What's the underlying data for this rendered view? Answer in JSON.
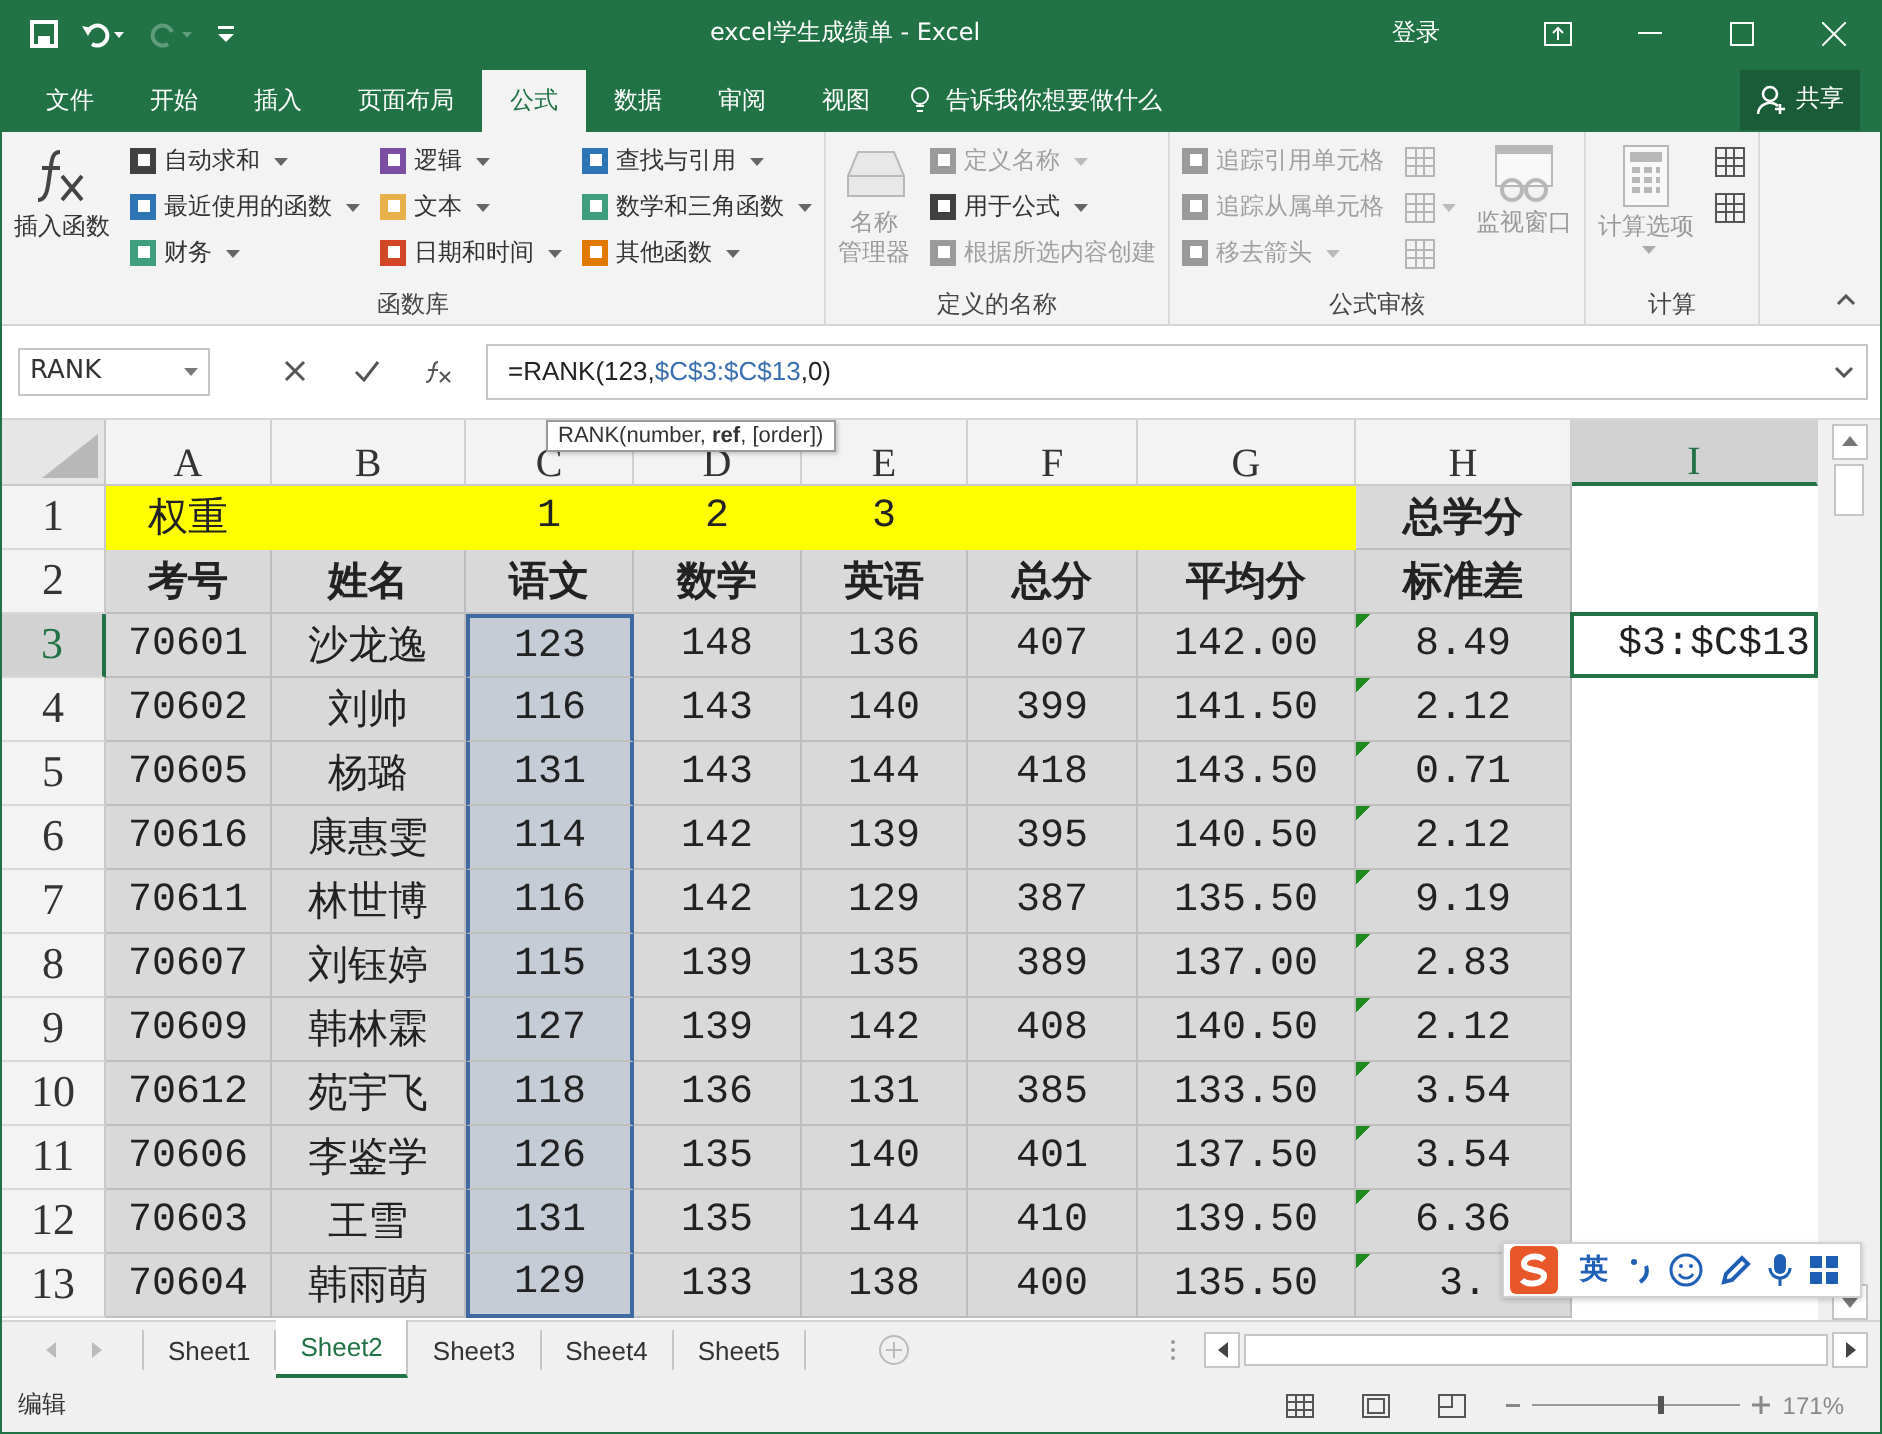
{
  "window": {
    "title": "excel学生成绩单 - Excel",
    "sign_in": "登录"
  },
  "ribbon_tabs": [
    {
      "label": "文件",
      "selected": false
    },
    {
      "label": "开始",
      "selected": false
    },
    {
      "label": "插入",
      "selected": false
    },
    {
      "label": "页面布局",
      "selected": false
    },
    {
      "label": "公式",
      "selected": true
    },
    {
      "label": "数据",
      "selected": false
    },
    {
      "label": "审阅",
      "selected": false
    },
    {
      "label": "视图",
      "selected": false
    }
  ],
  "tell_me": {
    "placeholder": "告诉我你想要做什么"
  },
  "share": "共享",
  "ribbon": {
    "groups": [
      {
        "label": "函数库",
        "parts": [
          {
            "kind": "large",
            "lines": [
              "插入函数"
            ],
            "disabled": false,
            "dropdown": false
          },
          {
            "kind": "stack",
            "items": [
              {
                "label": "自动求和",
                "dropdown": true,
                "disabled": false,
                "color": "#404040"
              },
              {
                "label": "最近使用的函数",
                "dropdown": true,
                "disabled": false,
                "color": "#2e75b6"
              },
              {
                "label": "财务",
                "dropdown": true,
                "disabled": false,
                "color": "#3f9e7e"
              }
            ]
          },
          {
            "kind": "stack",
            "items": [
              {
                "label": "逻辑",
                "dropdown": true,
                "disabled": false,
                "color": "#7c4ea3"
              },
              {
                "label": "文本",
                "dropdown": true,
                "disabled": false,
                "color": "#e8b04a"
              },
              {
                "label": "日期和时间",
                "dropdown": true,
                "disabled": false,
                "color": "#d24726"
              }
            ]
          },
          {
            "kind": "stack",
            "items": [
              {
                "label": "查找与引用",
                "dropdown": true,
                "disabled": false,
                "color": "#2e75b6"
              },
              {
                "label": "数学和三角函数",
                "dropdown": true,
                "disabled": false,
                "color": "#3f9e7e"
              },
              {
                "label": "其他函数",
                "dropdown": true,
                "disabled": false,
                "color": "#e07b00"
              }
            ]
          }
        ]
      },
      {
        "label": "定义的名称",
        "parts": [
          {
            "kind": "large",
            "lines": [
              "名称",
              "管理器"
            ],
            "disabled": true,
            "dropdown": false
          },
          {
            "kind": "stack",
            "items": [
              {
                "label": "定义名称",
                "dropdown": true,
                "disabled": true,
                "color": "#9a9a9a"
              },
              {
                "label": "用于公式",
                "dropdown": true,
                "disabled": false,
                "color": "#404040"
              },
              {
                "label": "根据所选内容创建",
                "dropdown": false,
                "disabled": true,
                "color": "#9a9a9a"
              }
            ]
          }
        ]
      },
      {
        "label": "公式审核",
        "parts": [
          {
            "kind": "stack",
            "items": [
              {
                "label": "追踪引用单元格",
                "dropdown": false,
                "disabled": true,
                "color": "#9a9a9a"
              },
              {
                "label": "追踪从属单元格",
                "dropdown": false,
                "disabled": true,
                "color": "#9a9a9a"
              },
              {
                "label": "移去箭头",
                "dropdown": true,
                "disabled": true,
                "color": "#9a9a9a"
              }
            ]
          },
          {
            "kind": "icons",
            "items": [
              {
                "disabled": true,
                "dropdown": false
              },
              {
                "disabled": true,
                "dropdown": true
              },
              {
                "disabled": true,
                "dropdown": false
              }
            ]
          },
          {
            "kind": "large",
            "lines": [
              "监视窗口"
            ],
            "disabled": true,
            "dropdown": false
          }
        ]
      },
      {
        "label": "计算",
        "parts": [
          {
            "kind": "large",
            "lines": [
              "计算选项"
            ],
            "disabled": true,
            "dropdown": true
          },
          {
            "kind": "icons",
            "items": [
              {
                "disabled": false,
                "dropdown": false
              },
              {
                "disabled": false,
                "dropdown": false
              }
            ]
          }
        ]
      }
    ]
  },
  "formula_bar": {
    "name_box": "RANK",
    "formula": {
      "prefix": "=RANK(123,",
      "reference": "$C$3:$C$13",
      "suffix": ",0)"
    }
  },
  "tooltip": "RANK(number, **ref**, [order])",
  "columns": [
    {
      "label": "A",
      "selected": false,
      "range": false
    },
    {
      "label": "B",
      "selected": false,
      "range": false
    },
    {
      "label": "C",
      "selected": false,
      "range": true
    },
    {
      "label": "D",
      "selected": false,
      "range": false
    },
    {
      "label": "E",
      "selected": false,
      "range": false
    },
    {
      "label": "F",
      "selected": false,
      "range": false
    },
    {
      "label": "G",
      "selected": false,
      "range": false
    },
    {
      "label": "H",
      "selected": false,
      "range": false
    },
    {
      "label": "I",
      "selected": true,
      "range": false
    }
  ],
  "rows": [
    {
      "number": "1",
      "kind": "weights",
      "selected": false,
      "range": false,
      "flag": false,
      "cells": [
        "权重",
        null,
        "1",
        "2",
        "3",
        null,
        null,
        "总学分",
        null
      ]
    },
    {
      "number": "2",
      "kind": "header",
      "selected": false,
      "range": false,
      "flag": false,
      "cells": [
        "考号",
        "姓名",
        "语文",
        "数学",
        "英语",
        "总分",
        "平均分",
        "标准差",
        null
      ]
    },
    {
      "number": "3",
      "kind": "data",
      "selected": true,
      "range": true,
      "flag": true,
      "cells": [
        "70601",
        "沙龙逸",
        "123",
        "148",
        "136",
        "407",
        "142.00",
        "8.49",
        null
      ]
    },
    {
      "number": "4",
      "kind": "data",
      "selected": false,
      "range": true,
      "flag": true,
      "cells": [
        "70602",
        "刘帅",
        "116",
        "143",
        "140",
        "399",
        "141.50",
        "2.12",
        null
      ]
    },
    {
      "number": "5",
      "kind": "data",
      "selected": false,
      "range": true,
      "flag": true,
      "cells": [
        "70605",
        "杨璐",
        "131",
        "143",
        "144",
        "418",
        "143.50",
        "0.71",
        null
      ]
    },
    {
      "number": "6",
      "kind": "data",
      "selected": false,
      "range": true,
      "flag": true,
      "cells": [
        "70616",
        "康惠雯",
        "114",
        "142",
        "139",
        "395",
        "140.50",
        "2.12",
        null
      ]
    },
    {
      "number": "7",
      "kind": "data",
      "selected": false,
      "range": true,
      "flag": true,
      "cells": [
        "70611",
        "林世博",
        "116",
        "142",
        "129",
        "387",
        "135.50",
        "9.19",
        null
      ]
    },
    {
      "number": "8",
      "kind": "data",
      "selected": false,
      "range": true,
      "flag": true,
      "cells": [
        "70607",
        "刘钰婷",
        "115",
        "139",
        "135",
        "389",
        "137.00",
        "2.83",
        null
      ]
    },
    {
      "number": "9",
      "kind": "data",
      "selected": false,
      "range": true,
      "flag": true,
      "cells": [
        "70609",
        "韩林霖",
        "127",
        "139",
        "142",
        "408",
        "140.50",
        "2.12",
        null
      ]
    },
    {
      "number": "10",
      "kind": "data",
      "selected": false,
      "range": true,
      "flag": true,
      "cells": [
        "70612",
        "苑宇飞",
        "118",
        "136",
        "131",
        "385",
        "133.50",
        "3.54",
        null
      ]
    },
    {
      "number": "11",
      "kind": "data",
      "selected": false,
      "range": true,
      "flag": true,
      "cells": [
        "70606",
        "李鉴学",
        "126",
        "135",
        "140",
        "401",
        "137.50",
        "3.54",
        null
      ]
    },
    {
      "number": "12",
      "kind": "data",
      "selected": false,
      "range": true,
      "flag": true,
      "cells": [
        "70603",
        "王雪",
        "131",
        "135",
        "144",
        "410",
        "139.50",
        "6.36",
        null
      ]
    },
    {
      "number": "13",
      "kind": "data",
      "selected": false,
      "range": true,
      "flag": true,
      "cells": [
        "70604",
        "韩雨萌",
        "129",
        "133",
        "138",
        "400",
        "135.50",
        "3.",
        null
      ]
    }
  ],
  "editor": {
    "text": "$3:$C$13"
  },
  "sheets": [
    {
      "label": "Sheet1",
      "selected": false
    },
    {
      "label": "Sheet2",
      "selected": true
    },
    {
      "label": "Sheet3",
      "selected": false
    },
    {
      "label": "Sheet4",
      "selected": false
    },
    {
      "label": "Sheet5",
      "selected": false
    }
  ],
  "status_bar": {
    "mode": "编辑",
    "zoom": "171%",
    "zoom_slider": {
      "level": 0.62
    }
  },
  "ime_toolbar": {
    "language": "英"
  }
}
